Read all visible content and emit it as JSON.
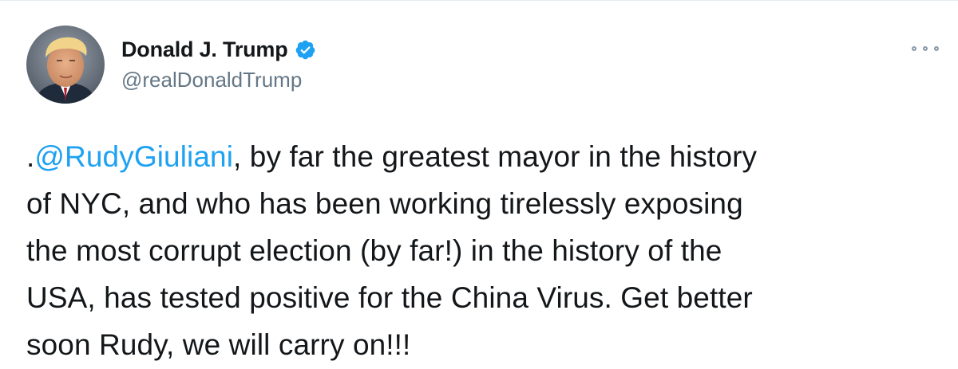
{
  "tweet": {
    "display_name": "Donald J. Trump",
    "handle": "@realDonaldTrump",
    "verified_icon": "verified-badge-icon",
    "more_icon": "more-options-icon",
    "accent_color": "#1da1f2",
    "text": {
      "prefix": ".",
      "mention": "@RudyGiuliani",
      "line1_rest": ", by far the greatest mayor in the history",
      "line2": "of NYC, and who has been working tirelessly exposing",
      "line3": "the most corrupt election (by far!) in the history of the",
      "line4": "USA, has tested positive for the China Virus. Get better",
      "line5": "soon Rudy, we will carry on!!!"
    }
  }
}
